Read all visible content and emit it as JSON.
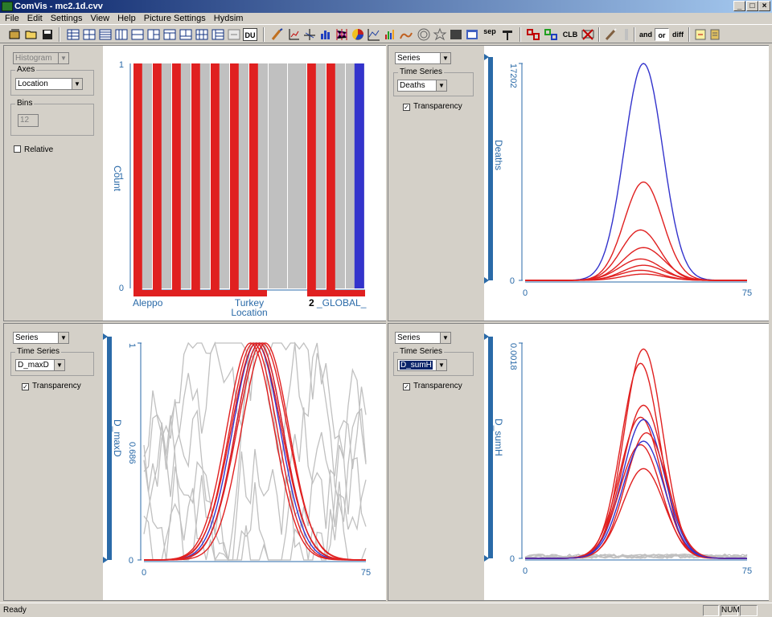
{
  "window": {
    "title": "ComVis - mc2.1d.cvv"
  },
  "menu": [
    "File",
    "Edit",
    "Settings",
    "View",
    "Help",
    "Picture Settings",
    "Hydsim"
  ],
  "toolbar": {
    "icons": [
      "open-workspace-icon",
      "open-folder-icon",
      "save-icon",
      "view-table-icon",
      "view-grid-icon",
      "view-list-icon",
      "view-columns-icon",
      "view-split-icon",
      "view-rows-icon",
      "view-panels-icon",
      "view-tiles-icon",
      "view-cells-icon",
      "view-stack-icon",
      "view-link-icon",
      "du-view-icon",
      "brush-icon",
      "axes-icon",
      "scatter-axes-icon",
      "bar-chart-icon",
      "parallel-coords-icon",
      "pie-chart-icon",
      "series-chart-icon",
      "area-chart-icon",
      "radial-icon",
      "star-icon",
      "heatmap-icon",
      "map-icon",
      "sep-icon",
      "hammer-icon",
      "red-squares-icon",
      "green-squares-icon",
      "clear-icon",
      "delete-brush-icon",
      "wand-icon",
      "stack-icon",
      "note-icon",
      "window-icon"
    ],
    "du_label": "DU",
    "sep_label": "sep",
    "clb_label": "CLB",
    "and_label": "and",
    "or_label": "or",
    "diff_label": "diff"
  },
  "panels": {
    "histogram": {
      "view_type": "Histogram",
      "axes_label": "Axes",
      "axes_value": "Location",
      "bins_label": "Bins",
      "bins_value": "12",
      "relative_label": "Relative",
      "relative_checked": false
    },
    "deaths": {
      "view_type": "Series",
      "ts_label": "Time Series",
      "ts_value": "Deaths",
      "transparency_label": "Transparency",
      "transparency_checked": true
    },
    "maxd": {
      "view_type": "Series",
      "ts_label": "Time Series",
      "ts_value": "D_maxD",
      "transparency_label": "Transparency",
      "transparency_checked": true
    },
    "sumh": {
      "view_type": "Series",
      "ts_label": "Time Series",
      "ts_value": "D_sumH",
      "transparency_label": "Transparency",
      "transparency_checked": true
    }
  },
  "chart_data": [
    {
      "type": "bar",
      "ylabel": "Count",
      "xlabel": "Location",
      "y_ticks": [
        "1",
        "1",
        "0"
      ],
      "x_tick_labels": [
        "Aleppo",
        "Turkey",
        "_GLOBAL_"
      ],
      "marker": "2",
      "categories": 12,
      "series": [
        {
          "name": "selected",
          "color": "#e02020",
          "values": [
            1,
            1,
            1,
            1,
            1,
            1,
            1,
            0,
            0,
            1,
            1,
            0
          ]
        },
        {
          "name": "highlight",
          "color": "#3333cc",
          "values": [
            0,
            0,
            0,
            0,
            0,
            0,
            0,
            0,
            0,
            0,
            0,
            1
          ]
        },
        {
          "name": "unselected",
          "color": "#c0c0c0",
          "values": [
            1,
            1,
            1,
            1,
            1,
            1,
            1,
            1,
            1,
            1,
            1,
            1
          ]
        }
      ]
    },
    {
      "type": "line",
      "ylabel": "Deaths",
      "y_ticks": [
        "17202",
        "0"
      ],
      "x_ticks": [
        "0",
        "75"
      ],
      "ylim": [
        0,
        17202
      ],
      "xlim": [
        0,
        75
      ],
      "series": [
        {
          "color": "#3333cc",
          "peak": 17202,
          "center": 40,
          "width": 6.5
        },
        {
          "color": "#e02020",
          "peak": 7800,
          "center": 40,
          "width": 6.5
        },
        {
          "color": "#e02020",
          "peak": 4000,
          "center": 39,
          "width": 6.5
        },
        {
          "color": "#e02020",
          "peak": 2600,
          "center": 40,
          "width": 7
        },
        {
          "color": "#e02020",
          "peak": 1700,
          "center": 39,
          "width": 7
        },
        {
          "color": "#e02020",
          "peak": 1200,
          "center": 40,
          "width": 7
        },
        {
          "color": "#e02020",
          "peak": 800,
          "center": 39,
          "width": 7
        },
        {
          "color": "#e02020",
          "peak": 500,
          "center": 40,
          "width": 7
        }
      ]
    },
    {
      "type": "line",
      "ylabel": "D_maxD",
      "y_ticks": [
        "1",
        "0.686",
        "0"
      ],
      "x_ticks": [
        "0",
        "75"
      ],
      "ylim": [
        0,
        1
      ],
      "xlim": [
        0,
        75
      ],
      "series": [
        {
          "color": "#3333cc",
          "peak": 1.0,
          "center": 38,
          "width": 8
        },
        {
          "color": "#3333cc",
          "peak": 1.0,
          "center": 39,
          "width": 8
        },
        {
          "color": "#e02020",
          "peak": 1.0,
          "center": 37,
          "width": 8
        },
        {
          "color": "#e02020",
          "peak": 1.0,
          "center": 38,
          "width": 8.5
        },
        {
          "color": "#e02020",
          "peak": 1.0,
          "center": 39,
          "width": 8
        },
        {
          "color": "#e02020",
          "peak": 1.0,
          "center": 40,
          "width": 8.5
        },
        {
          "color": "#e02020",
          "peak": 1.0,
          "center": 41,
          "width": 8
        },
        {
          "color": "#e02020",
          "peak": 1.0,
          "center": 36,
          "width": 8
        }
      ]
    },
    {
      "type": "line",
      "ylabel": "D_sumH",
      "y_ticks": [
        "0.0018",
        "0"
      ],
      "x_ticks": [
        "0",
        "75"
      ],
      "ylim": [
        0,
        0.0018
      ],
      "xlim": [
        0,
        75
      ],
      "series": [
        {
          "color": "#e02020",
          "peak": 0.00175,
          "center": 40,
          "width": 6.5
        },
        {
          "color": "#e02020",
          "peak": 0.00163,
          "center": 39,
          "width": 6.5
        },
        {
          "color": "#e02020",
          "peak": 0.00128,
          "center": 40,
          "width": 7
        },
        {
          "color": "#e02020",
          "peak": 0.00118,
          "center": 39,
          "width": 7
        },
        {
          "color": "#3333cc",
          "peak": 0.00116,
          "center": 40,
          "width": 7
        },
        {
          "color": "#e02020",
          "peak": 0.00105,
          "center": 41,
          "width": 7
        },
        {
          "color": "#e02020",
          "peak": 0.00095,
          "center": 39,
          "width": 7
        },
        {
          "color": "#e02020",
          "peak": 0.00075,
          "center": 40,
          "width": 7
        },
        {
          "color": "#3333cc",
          "peak": 0.00098,
          "center": 40,
          "width": 7
        }
      ]
    }
  ],
  "status": {
    "text": "Ready",
    "num": "NUM"
  }
}
